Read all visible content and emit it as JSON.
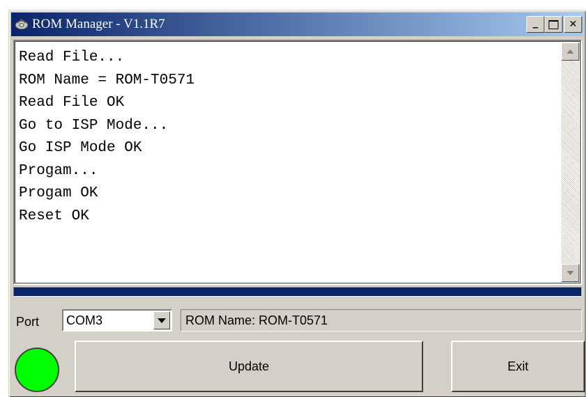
{
  "window": {
    "title": "ROM Manager - V1.1R7",
    "minimize_glyph": "_",
    "maximize_glyph": "□",
    "close_glyph": "✕",
    "icon": "disc-icon"
  },
  "log": {
    "lines": [
      "Read File...",
      "ROM Name = ROM-T0571",
      "Read File OK",
      "Go to ISP Mode...",
      "Go ISP Mode OK",
      "Progam...",
      "Progam OK",
      "Reset OK"
    ]
  },
  "progress": {
    "fraction": 1.0,
    "color": "#0a246a"
  },
  "port": {
    "label": "Port",
    "selected": "COM3"
  },
  "status": {
    "text": "ROM Name: ROM-T0571"
  },
  "indicator": {
    "color": "#00ff00",
    "state": "ok"
  },
  "buttons": {
    "update_label": "Update",
    "exit_label": "Exit"
  }
}
